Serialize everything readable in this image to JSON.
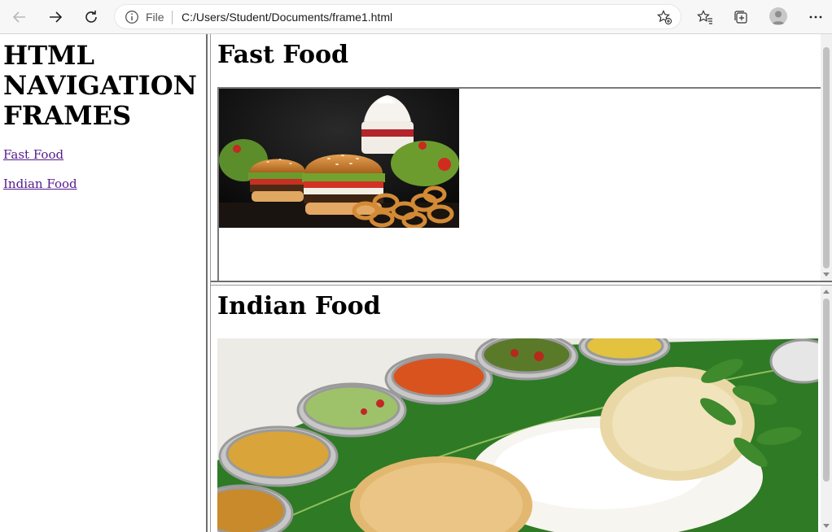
{
  "browser": {
    "address_label": "File",
    "url": "C:/Users/Student/Documents/frame1.html",
    "icons": [
      "back-arrow-icon",
      "forward-arrow-icon",
      "reload-icon",
      "info-icon",
      "add-favorite-icon",
      "favorites-icon",
      "collections-icon",
      "profile-icon",
      "more-icon"
    ]
  },
  "left_frame": {
    "title": "HTML NAVIGATION FRAMES",
    "links": [
      {
        "label": "Fast Food"
      },
      {
        "label": "Indian Food"
      }
    ]
  },
  "top_frame": {
    "heading": "Fast Food",
    "image": "fast-food-burgers-photo"
  },
  "bottom_frame": {
    "heading": "Indian Food",
    "image": "indian-thali-banana-leaf-photo"
  },
  "colors": {
    "visited_link": "#551a8b",
    "frame_border": "#6e6e6e",
    "chrome_bg": "#f7f7f7"
  }
}
